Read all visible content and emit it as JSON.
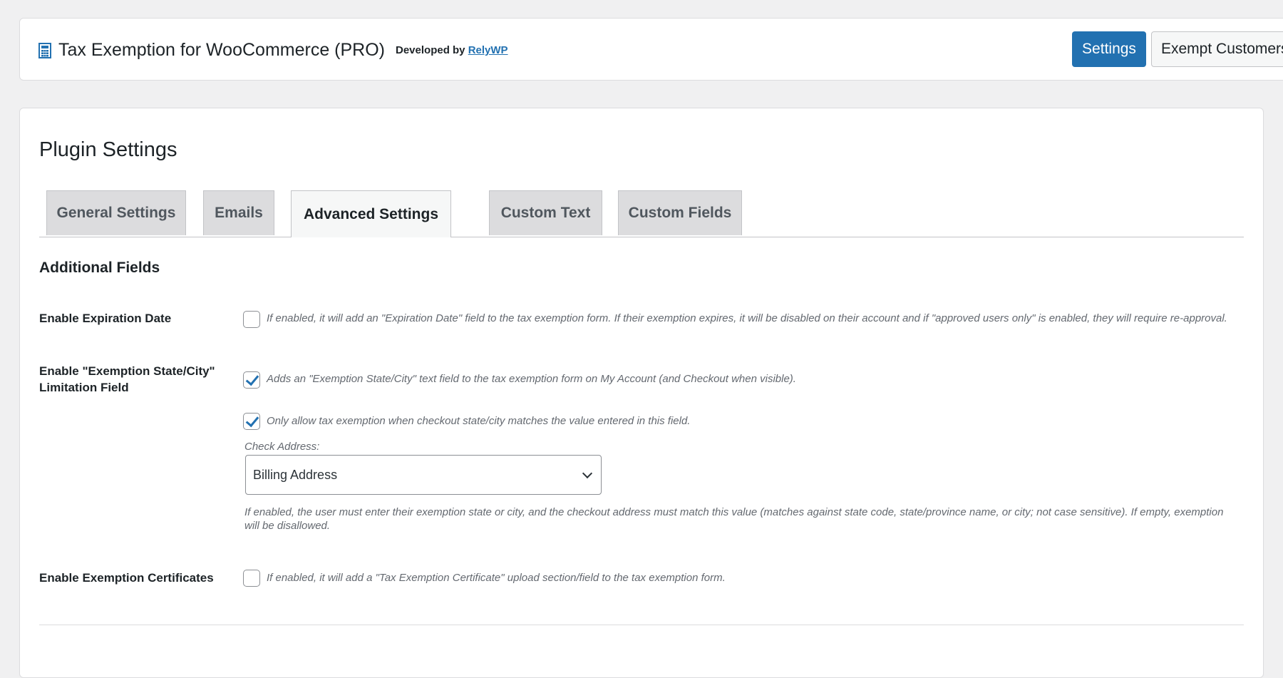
{
  "header": {
    "title": "Tax Exemption for WooCommerce (PRO)",
    "developed_by": "Developed by ",
    "developer_link": "RelyWP",
    "buttons": {
      "settings": "Settings",
      "exempt_customers": "Exempt Customers"
    },
    "accent_color": "#2271b1"
  },
  "page": {
    "title": "Plugin Settings"
  },
  "tabs": [
    {
      "label": "General Settings",
      "active": false
    },
    {
      "label": "Emails",
      "active": false
    },
    {
      "label": "Advanced Settings",
      "active": true
    },
    {
      "label": "Custom Text",
      "active": false
    },
    {
      "label": "Custom Fields",
      "active": false
    }
  ],
  "section": {
    "title": "Additional Fields"
  },
  "fields": {
    "expiration": {
      "label": "Enable Expiration Date",
      "checked": false,
      "description": "If enabled, it will add an \"Expiration Date\" field to the tax exemption form. If their exemption expires, it will be disabled on their account and if \"approved users only\" is enabled, they will require re-approval."
    },
    "state_city": {
      "label": "Enable \"Exemption State/City\" Limitation Field",
      "checked": true,
      "description": "Adds an \"Exemption State/City\" text field to the tax exemption form on My Account (and Checkout when visible).",
      "only_allow": {
        "checked": true,
        "description": "Only allow tax exemption when checkout state/city matches the value entered in this field."
      },
      "check_address_label": "Check Address:",
      "check_address_value": "Billing Address",
      "help": "If enabled, the user must enter their exemption state or city, and the checkout address must match this value (matches against state code, state/province name, or city; not case sensitive). If empty, exemption will be disallowed."
    },
    "certificates": {
      "label": "Enable Exemption Certificates",
      "checked": false,
      "description": "If enabled, it will add a \"Tax Exemption Certificate\" upload section/field to the tax exemption form."
    }
  }
}
